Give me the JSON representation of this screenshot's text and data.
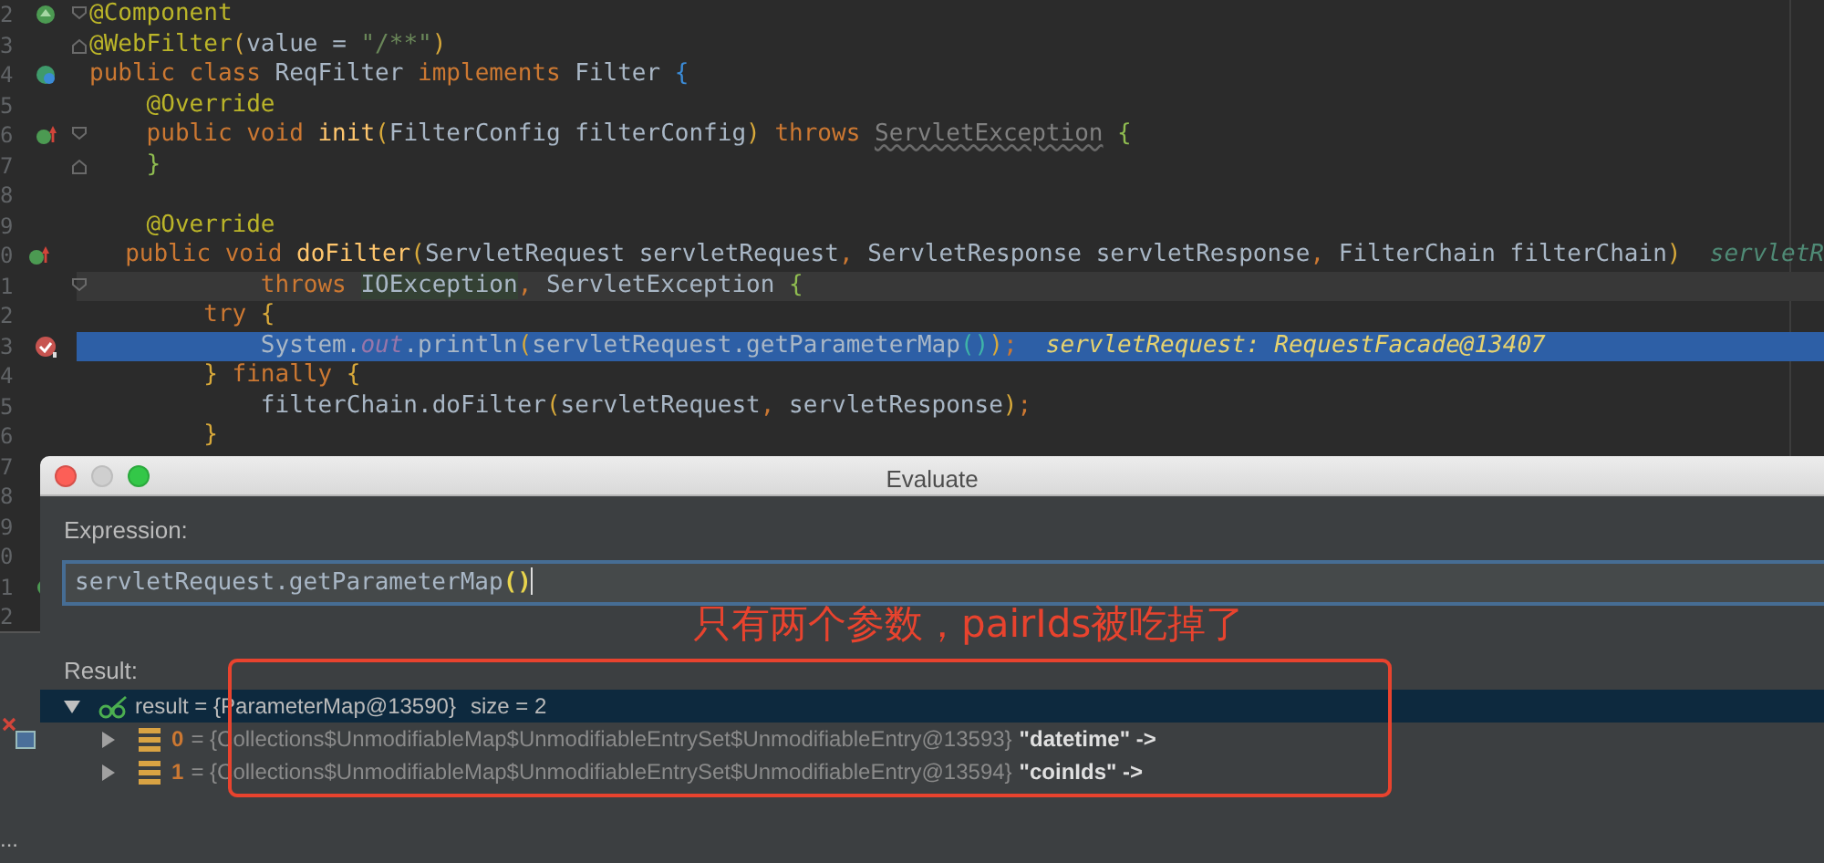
{
  "code_lines": [
    {
      "number": "2",
      "kind": "bean",
      "fold_start": true,
      "fold_end": false,
      "caret_line": false,
      "execution": false,
      "tokens": [
        {
          "text": "@Component",
          "kind": "ann"
        }
      ]
    },
    {
      "number": "3",
      "kind": "plain",
      "fold_start": false,
      "fold_end": true,
      "caret_line": false,
      "execution": false,
      "tokens": [
        {
          "text": "@WebFilter",
          "kind": "ann"
        },
        {
          "text": "(",
          "kind": "b1"
        },
        {
          "text": "value = ",
          "kind": "txt"
        },
        {
          "text": "\"/**\"",
          "kind": "str"
        },
        {
          "text": ")",
          "kind": "b1"
        }
      ]
    },
    {
      "number": "4",
      "kind": "implements",
      "fold_start": false,
      "fold_end": false,
      "caret_line": false,
      "execution": false,
      "tokens": [
        {
          "text": "public class ",
          "kind": "kw"
        },
        {
          "text": "ReqFilter ",
          "kind": "txt"
        },
        {
          "text": "implements ",
          "kind": "kw"
        },
        {
          "text": "Filter ",
          "kind": "txt"
        },
        {
          "text": "{",
          "kind": "b3"
        }
      ]
    },
    {
      "number": "5",
      "kind": "plain",
      "fold_start": false,
      "fold_end": false,
      "caret_line": false,
      "execution": false,
      "tokens": [
        {
          "text": "    @Override",
          "kind": "ann"
        }
      ]
    },
    {
      "number": "6",
      "kind": "overrides",
      "fold_start": true,
      "fold_end": false,
      "caret_line": false,
      "execution": false,
      "tokens": [
        {
          "text": "    public void ",
          "kind": "kw"
        },
        {
          "text": "init",
          "kind": "method"
        },
        {
          "text": "(",
          "kind": "b1"
        },
        {
          "text": "FilterConfig filterConfig",
          "kind": "txt"
        },
        {
          "text": ")",
          "kind": "b1"
        },
        {
          "text": " throws ",
          "kind": "kw"
        },
        {
          "text": "ServletException",
          "kind": "unused"
        },
        {
          "text": " {",
          "kind": "b2"
        }
      ]
    },
    {
      "number": "7",
      "kind": "plain",
      "fold_start": false,
      "fold_end": true,
      "caret_line": false,
      "execution": false,
      "tokens": [
        {
          "text": "    }",
          "kind": "b2"
        }
      ]
    },
    {
      "number": "8",
      "kind": "plain",
      "fold_start": false,
      "fold_end": false,
      "caret_line": false,
      "execution": false
    },
    {
      "number": "9",
      "kind": "plain",
      "fold_start": false,
      "fold_end": false,
      "caret_line": false,
      "execution": false,
      "tokens": [
        {
          "text": "    @Override",
          "kind": "ann"
        }
      ]
    },
    {
      "number": "0",
      "kind": "overrides",
      "fold_start": false,
      "fold_end": false,
      "caret_line": false,
      "execution": false,
      "tokens": [
        {
          "text": "    public void ",
          "kind": "kw"
        },
        {
          "text": "doFilter",
          "kind": "method"
        },
        {
          "text": "(",
          "kind": "b1"
        },
        {
          "text": "ServletRequest servletRequest",
          "kind": "txt"
        },
        {
          "text": ", ",
          "kind": "punct"
        },
        {
          "text": "ServletResponse servletResponse",
          "kind": "txt"
        },
        {
          "text": ", ",
          "kind": "punct"
        },
        {
          "text": "FilterChain filterChain",
          "kind": "txt"
        },
        {
          "text": ")",
          "kind": "b1"
        },
        {
          "text": "servletR",
          "kind": "hint"
        }
      ]
    },
    {
      "number": "1",
      "kind": "plain",
      "fold_start": true,
      "fold_end": false,
      "caret_line": true,
      "execution": false,
      "tokens": [
        {
          "text": "            throws ",
          "kind": "kw"
        },
        {
          "text": "IOException",
          "kind": "marked"
        },
        {
          "text": ", ",
          "kind": "punct"
        },
        {
          "text": "ServletException ",
          "kind": "txt"
        },
        {
          "text": "{",
          "kind": "b2"
        }
      ]
    },
    {
      "number": "2",
      "kind": "plain",
      "fold_start": false,
      "fold_end": false,
      "caret_line": false,
      "execution": false,
      "tokens": [
        {
          "text": "        try ",
          "kind": "kw"
        },
        {
          "text": "{",
          "kind": "b1"
        }
      ]
    },
    {
      "number": "3",
      "kind": "breakpoint",
      "fold_start": false,
      "fold_end": false,
      "caret_line": false,
      "execution": true,
      "tokens": [
        {
          "text": "            System.",
          "kind": "txt"
        },
        {
          "text": "out",
          "kind": "field"
        },
        {
          "text": ".println",
          "kind": "txt"
        },
        {
          "text": "(",
          "kind": "b1"
        },
        {
          "text": "servletRequest.getParameterMap",
          "kind": "txt"
        },
        {
          "text": "()",
          "kind": "b4"
        },
        {
          "text": ")",
          "kind": "b1"
        },
        {
          "text": ";",
          "kind": "punct"
        },
        {
          "text": "servletRequest: RequestFacade@13407",
          "kind": "value"
        }
      ]
    },
    {
      "number": "4",
      "kind": "plain",
      "fold_start": false,
      "fold_end": false,
      "caret_line": false,
      "execution": false,
      "tokens": [
        {
          "text": "        }",
          "kind": "b1"
        },
        {
          "text": " finally ",
          "kind": "kw"
        },
        {
          "text": "{",
          "kind": "b1"
        }
      ]
    },
    {
      "number": "5",
      "kind": "plain",
      "fold_start": false,
      "fold_end": false,
      "caret_line": false,
      "execution": false,
      "tokens": [
        {
          "text": "            filterChain.doFilter",
          "kind": "txt"
        },
        {
          "text": "(",
          "kind": "b1"
        },
        {
          "text": "servletRequest",
          "kind": "txt"
        },
        {
          "text": ", ",
          "kind": "punct"
        },
        {
          "text": "servletResponse",
          "kind": "txt"
        },
        {
          "text": ")",
          "kind": "b1"
        },
        {
          "text": ";",
          "kind": "punct"
        }
      ]
    },
    {
      "number": "6",
      "kind": "plain",
      "fold_start": false,
      "fold_end": false,
      "caret_line": false,
      "execution": false,
      "tokens": [
        {
          "text": "        }",
          "kind": "b1"
        }
      ]
    },
    {
      "number": "7",
      "kind": "plain"
    },
    {
      "number": "8",
      "kind": "plain"
    },
    {
      "number": "9",
      "kind": "plain"
    },
    {
      "number": "0",
      "kind": "plain"
    },
    {
      "number": "1",
      "kind": "method"
    },
    {
      "number": "2",
      "kind": "plain"
    }
  ],
  "side_panel": {
    "more_label": "..."
  },
  "dialog": {
    "title": "Evaluate",
    "window_buttons": [
      {
        "kind": "close",
        "enabled": true
      },
      {
        "kind": "minimize",
        "enabled": false
      },
      {
        "kind": "zoom",
        "enabled": true
      }
    ],
    "expression_label": "Expression:",
    "expression": [
      {
        "text": "servletRequest.getParameterMap",
        "kind": "txt"
      },
      {
        "text": "()",
        "kind": "match"
      }
    ],
    "result_label": "Result:",
    "result": [
      {
        "label": "result = {ParameterMap@13590}",
        "extra": "size = 2",
        "expanded": true,
        "selected": true,
        "children": [
          {
            "index": "0",
            "value": "= {Collections$UnmodifiableMap$UnmodifiableEntrySet$UnmodifiableEntry@13593}",
            "key_label": "\"datetime\" ->",
            "expanded": false,
            "selected": false
          },
          {
            "index": "1",
            "value": "= {Collections$UnmodifiableMap$UnmodifiableEntrySet$UnmodifiableEntry@13594}",
            "key_label": "\"coinIds\" ->",
            "expanded": false,
            "selected": false
          }
        ]
      }
    ],
    "annotation": {
      "text": "只有两个参数，pairIds被吃掉了",
      "color": "#e8432e"
    }
  }
}
